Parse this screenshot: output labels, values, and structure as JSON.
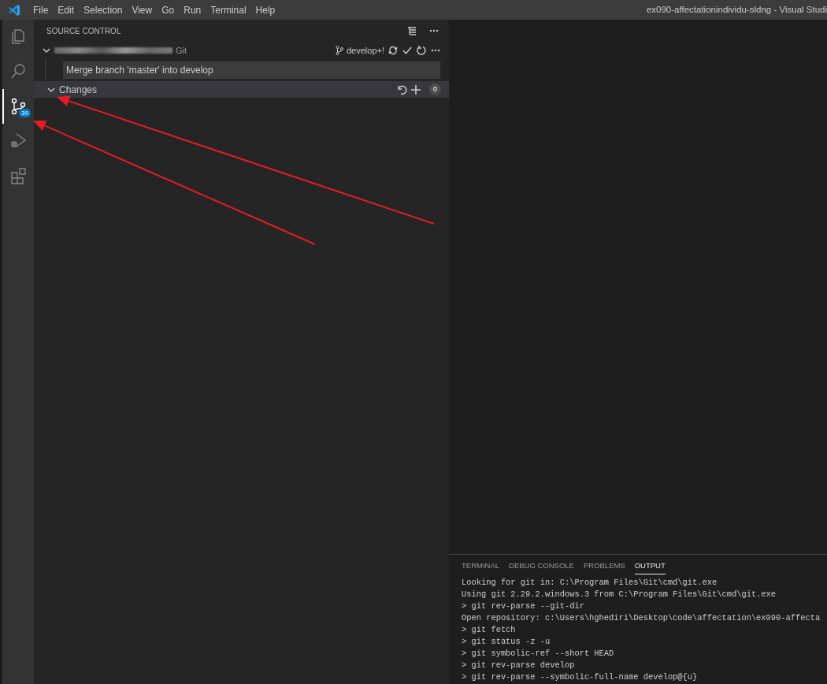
{
  "title_bar": {
    "menu": [
      "File",
      "Edit",
      "Selection",
      "View",
      "Go",
      "Run",
      "Terminal",
      "Help"
    ],
    "title": "ex090-affectationindividu-sldng - Visual Studi"
  },
  "activity_bar": [
    {
      "kind": "files",
      "selected": false
    },
    {
      "kind": "search",
      "selected": false
    },
    {
      "kind": "source-control",
      "selected": true,
      "badge": "39"
    },
    {
      "kind": "run",
      "selected": false
    },
    {
      "kind": "extensions",
      "selected": false
    }
  ],
  "sidebar": {
    "title": "SOURCE CONTROL",
    "repository": {
      "expanded": true,
      "provider": "Git",
      "branch": "develop+!",
      "commit_message": "Merge branch 'master' into develop"
    },
    "changes": {
      "label": "Changes",
      "expanded": true,
      "count": "0"
    }
  },
  "panel": {
    "tabs": [
      {
        "label": "TERMINAL",
        "selected": false
      },
      {
        "label": "DEBUG CONSOLE",
        "selected": false
      },
      {
        "label": "PROBLEMS",
        "selected": false
      },
      {
        "label": "OUTPUT",
        "selected": true
      }
    ],
    "output": [
      "Looking for git in: C:\\Program Files\\Git\\cmd\\git.exe",
      "Using git 2.29.2.windows.3 from C:\\Program Files\\Git\\cmd\\git.exe",
      "> git rev-parse --git-dir",
      "Open repository: c:\\Users\\hghediri\\Desktop\\code\\affectation\\ex090-affecta",
      "> git fetch",
      "> git status -z -u",
      "> git symbolic-ref --short HEAD",
      "> git rev-parse develop",
      "> git rev-parse --symbolic-full-name develop@{u}"
    ]
  },
  "annotations": [
    {
      "kind": "arrow"
    },
    {
      "kind": "arrow"
    }
  ]
}
